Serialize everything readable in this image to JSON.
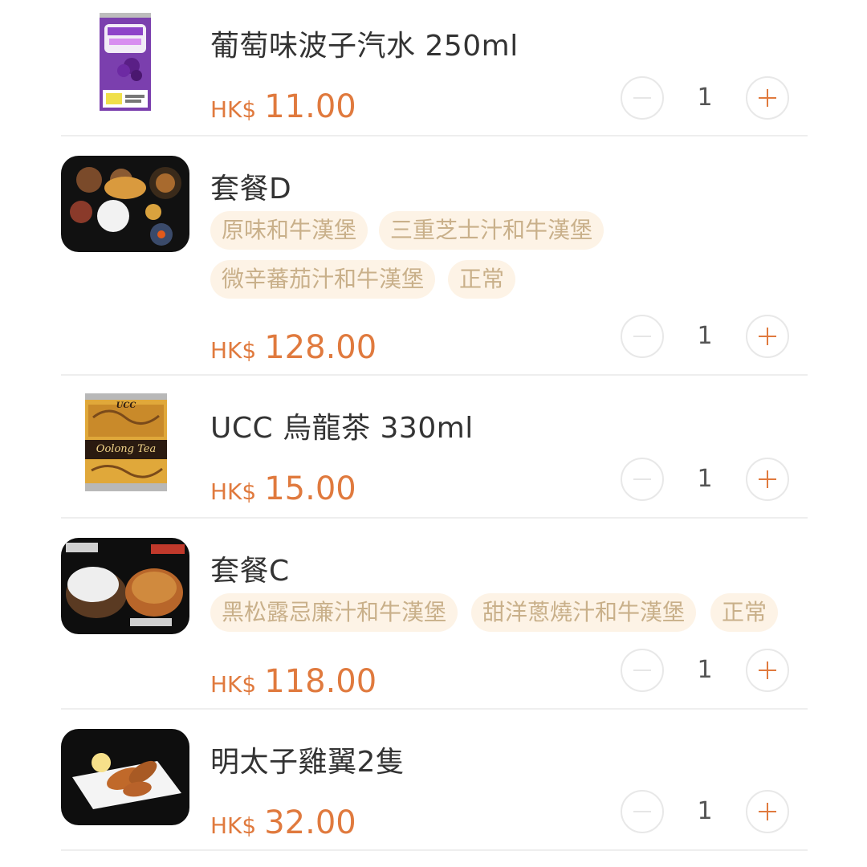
{
  "cart": {
    "currency": "HK$",
    "items": [
      {
        "name": "葡萄味波子汽水 250ml",
        "price": "11.00",
        "quantity": "1",
        "options": [],
        "image_icon": "grape-soda-can-icon"
      },
      {
        "name": "套餐D",
        "price": "128.00",
        "quantity": "1",
        "options": [
          "原味和牛漢堡",
          "三重芝士汁和牛漢堡",
          "微辛蕃茄汁和牛漢堡",
          "正常"
        ],
        "image_icon": "set-meal-tray-icon"
      },
      {
        "name": "UCC 烏龍茶 330ml",
        "price": "15.00",
        "quantity": "1",
        "options": [],
        "image_icon": "oolong-tea-can-icon",
        "image_text": [
          "UCC",
          "Oolong Tea"
        ]
      },
      {
        "name": "套餐C",
        "price": "118.00",
        "quantity": "1",
        "options": [
          "黑松露忌廉汁和牛漢堡",
          "甜洋蔥燒汁和牛漢堡",
          "正常"
        ],
        "image_icon": "hamburg-steak-icon"
      },
      {
        "name": "明太子雞翼2隻",
        "price": "32.00",
        "quantity": "1",
        "options": [],
        "image_icon": "chicken-wings-icon"
      }
    ]
  },
  "colors": {
    "accent": "#e07a3e",
    "tag_bg": "#fdf3e6",
    "tag_text": "#c9b08a",
    "text": "#333333"
  }
}
